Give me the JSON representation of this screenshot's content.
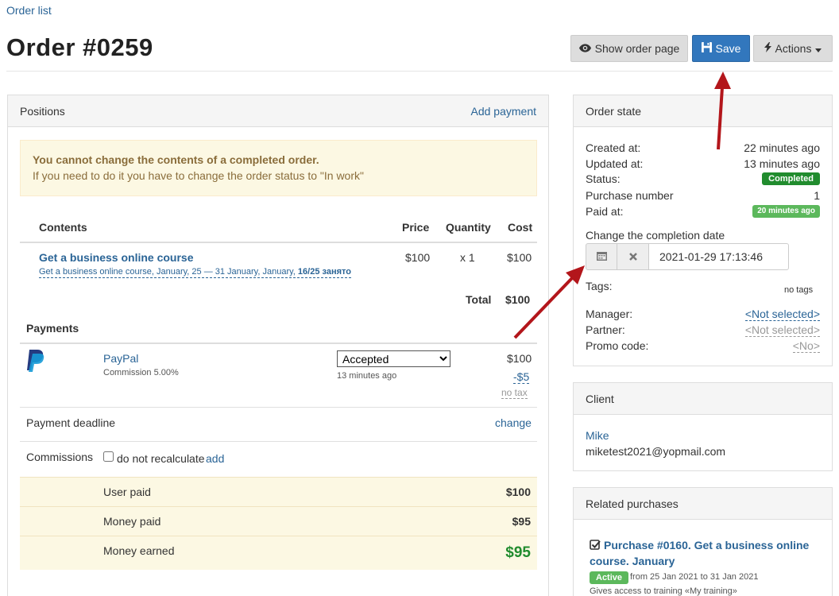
{
  "breadcrumb": "Order list",
  "title": "Order #0259",
  "toolbar": {
    "show_order_page": "Show order page",
    "save": "Save",
    "actions": "Actions"
  },
  "positions": {
    "header": "Positions",
    "add_payment": "Add payment",
    "alert_title": "You cannot change the contents of a completed order.",
    "alert_text": "If you need to do it you have to change the order status to \"In work\"",
    "columns": {
      "contents": "Contents",
      "price": "Price",
      "quantity": "Quantity",
      "cost": "Cost"
    },
    "item": {
      "name": "Get a business online course",
      "subtitle": "Get a business online course, January, 25 — 31 January, January,",
      "seats": "16/25 занято",
      "price": "$100",
      "quantity": "x 1",
      "cost": "$100"
    },
    "total_label": "Total",
    "total_value": "$100"
  },
  "payments": {
    "header": "Payments",
    "method": "PayPal",
    "commission": "Commission 5.00%",
    "status": "Accepted",
    "status_options": [
      "Accepted"
    ],
    "time": "13 minutes ago",
    "amount": "$100",
    "fee": "-$5",
    "tax": "no tax",
    "deadline_label": "Payment deadline",
    "deadline_change": "change",
    "commissions_label": "Commissions",
    "no_recalc": "do not recalculate",
    "add": "add"
  },
  "summary": [
    {
      "label": "User paid",
      "value": "$100"
    },
    {
      "label": "Money paid",
      "value": "$95"
    },
    {
      "label": "Money earned",
      "value": "$95"
    }
  ],
  "order_state": {
    "header": "Order state",
    "created_label": "Created at:",
    "created_value": "22 minutes ago",
    "updated_label": "Updated at:",
    "updated_value": "13 minutes ago",
    "status_label": "Status:",
    "status_value": "Completed",
    "purchase_label": "Purchase number",
    "purchase_value": "1",
    "paid_label": "Paid at:",
    "paid_value": "20 minutes ago",
    "completion_label": "Change the completion date",
    "completion_value": "2021-01-29 17:13:46",
    "tags_label": "Tags:",
    "tags_value": "no tags",
    "manager_label": "Manager:",
    "manager_value": "<Not selected>",
    "partner_label": "Partner:",
    "partner_value": "<Not selected>",
    "promo_label": "Promo code:",
    "promo_value": "<No>"
  },
  "client": {
    "header": "Client",
    "name": "Mike",
    "email": "miketest2021@yopmail.com"
  },
  "related": {
    "header": "Related purchases",
    "title_line1": "Purchase #0160. Get a business online",
    "title_line2": "course. January",
    "badge": "Active",
    "period": "from 25 Jan 2021 to 31 Jan 2021",
    "access": "Gives access to training «My training»"
  },
  "colors": {
    "accent": "#3277bd",
    "link": "#2a6496",
    "completed": "#218c2e",
    "paid": "#5cb85c",
    "earned": "#218c2e",
    "arrow": "#b3161b"
  }
}
